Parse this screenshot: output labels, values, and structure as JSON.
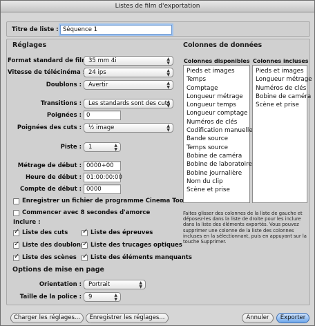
{
  "window": {
    "title": "Listes de film d'exportation"
  },
  "list_title": {
    "label": "Titre de liste :",
    "value": "Séquence 1"
  },
  "settings": {
    "section": "Réglages",
    "film_standard": {
      "label": "Format standard de film :",
      "value": "35 mm 4i"
    },
    "telecine_speed": {
      "label": "Vitesse de télécinéma :",
      "value": "24 ips"
    },
    "duplicates": {
      "label": "Doublons :",
      "value": "Avertir"
    },
    "transitions": {
      "label": "Transitions :",
      "value": "Les standards sont des cuts"
    },
    "handles": {
      "label": "Poignées :",
      "value": "0"
    },
    "cut_handles": {
      "label": "Poignées des cuts :",
      "value": "½ image"
    },
    "track": {
      "label": "Piste :",
      "value": "1"
    },
    "start_footage": {
      "label": "Métrage de début :",
      "value": "0000+00"
    },
    "start_time": {
      "label": "Heure de début :",
      "value": "01:00:00:00"
    },
    "start_count": {
      "label": "Compte de début :",
      "value": "0000"
    },
    "save_cinema_tools": {
      "label": "Enregistrer un fichier de programme Cinema Tools",
      "checked": false
    },
    "leader_8s": {
      "label": "Commencer avec 8 secondes d'amorce",
      "checked": false
    },
    "include_label": "Inclure :",
    "include": [
      {
        "label": "Liste des cuts",
        "checked": true
      },
      {
        "label": "Liste des épreuves",
        "checked": true
      },
      {
        "label": "Liste des doublons",
        "checked": true
      },
      {
        "label": "Liste des trucages optiques",
        "checked": true
      },
      {
        "label": "Liste des scènes",
        "checked": true
      },
      {
        "label": "Liste des éléments manquants",
        "checked": true
      }
    ]
  },
  "page_options": {
    "section": "Options de mise en page",
    "orientation": {
      "label": "Orientation :",
      "value": "Portrait"
    },
    "font_size": {
      "label": "Taille de la police :",
      "value": "9"
    }
  },
  "data_columns": {
    "section": "Colonnes de données",
    "available_header": "Colonnes disponibles",
    "included_header": "Colonnes incluses",
    "available": [
      "Pieds et images",
      "Temps",
      "Comptage",
      "Longueur métrage",
      "Longueur temps",
      "Longueur comptage",
      "Numéros de clés",
      "Codification manuelle",
      "Bande source",
      "Temps source",
      "Bobine de caméra",
      "Bobine de laboratoire",
      "Bobine journalière",
      "Nom du clip",
      "Scène et prise"
    ],
    "included": [
      "Pieds et images",
      "Longueur métrage",
      "Numéros de clés",
      "Bobine de caméra",
      "Scène et prise"
    ],
    "help": "Faites glisser des colonnes de la liste de gauche et déposez-les dans la liste de droite pour les inclure dans la liste des éléments exportés. Vous pouvez supprimer une colonne de la liste des colonnes incluses en la sélectionnant, puis en appuyant sur la touche Supprimer."
  },
  "buttons": {
    "load": "Charger les réglages...",
    "save": "Enregistrer les réglages...",
    "cancel": "Annuler",
    "export": "Exporter"
  }
}
